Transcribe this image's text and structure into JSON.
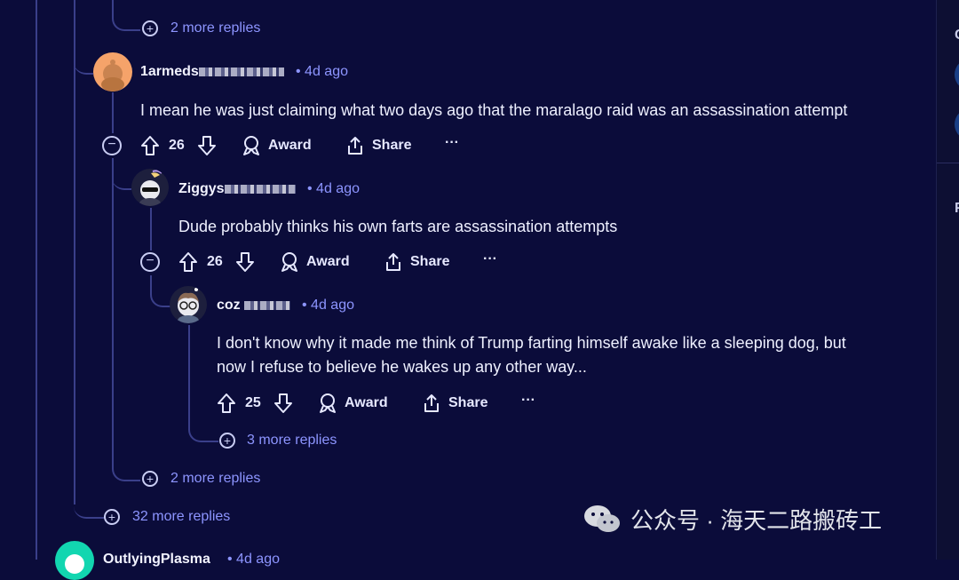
{
  "thread": {
    "top_more_replies": "2 more replies",
    "comment1": {
      "username": "1armeds",
      "time": "4d ago",
      "body": "I mean he was just claiming what two days ago that the maralago raid was an assassination attempt",
      "votes": "26",
      "award_label": "Award",
      "share_label": "Share",
      "more_label": "···"
    },
    "comment2": {
      "username": "Ziggys",
      "time": "4d ago",
      "body": "Dude probably thinks his own farts are assassination attempts",
      "votes": "26",
      "award_label": "Award",
      "share_label": "Share",
      "more_label": "···"
    },
    "comment3": {
      "username": "coz",
      "time": "4d ago",
      "body_line1": "I don't know why it made me think of Trump farting himself awake like a sleeping dog, but",
      "body_line2": "now I refuse to believe he wakes up any other way...",
      "votes": "25",
      "award_label": "Award",
      "share_label": "Share",
      "more_label": "···",
      "more_replies": "3 more replies"
    },
    "comment1_more_replies": "2 more replies",
    "root_more_replies": "32 more replies",
    "next_comment": {
      "username": "OutlyingPlasma",
      "time": "4d ago"
    }
  },
  "watermark": {
    "text": "公众号 · 海天二路搬砖工"
  },
  "sidebar": {
    "letter1": "C",
    "letter2": "F"
  },
  "colors": {
    "background": "#0b0c3a",
    "accent": "#8d95ff",
    "thread_line": "#3a3f8a"
  }
}
